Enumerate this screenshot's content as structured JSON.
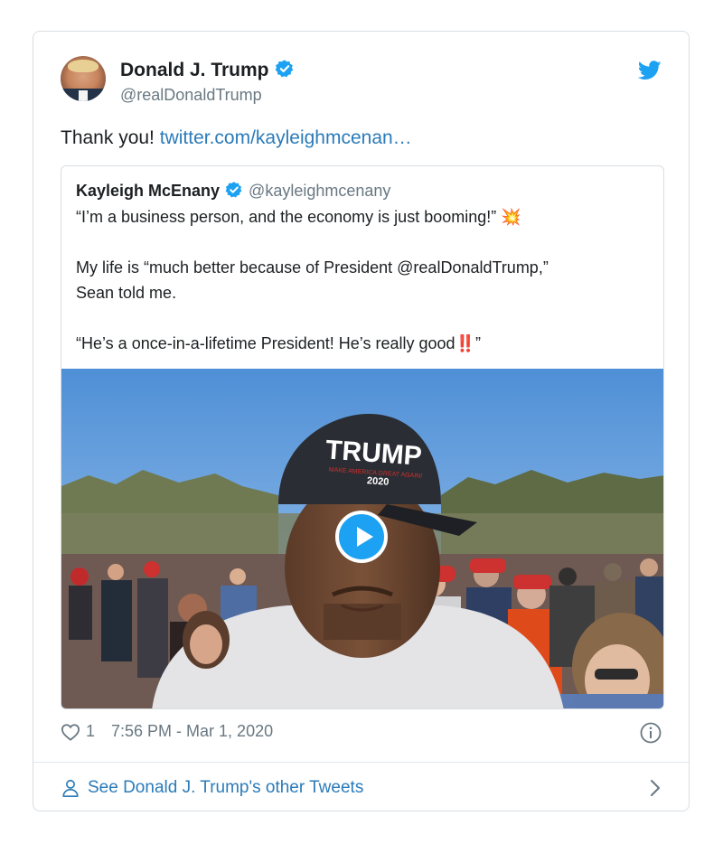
{
  "tweet": {
    "author_name": "Donald J. Trump",
    "author_handle": "@realDonaldTrump",
    "text": "Thank you! ",
    "link_text": "twitter.com/kayleighmcenan…",
    "likes": "1",
    "timestamp": "7:56 PM - Mar 1, 2020"
  },
  "quote": {
    "author_name": "Kayleigh McEnany",
    "author_handle": "@kayleighmcenany",
    "line1": "“I’m a business person, and the economy is just booming!”",
    "line2": "My life is “much better because of President @realDonaldTrump,”",
    "line3": "Sean told me.",
    "line4": "“He’s a once-in-a-lifetime President! He’s really good",
    "line4_end": "”",
    "emoji_collision": "💥",
    "emoji_bangs": "‼️"
  },
  "media": {
    "hat_text": "TRUMP",
    "hat_subtext": "MAKE AMERICA GREAT AGAIN!",
    "hat_year": "2020"
  },
  "footer": {
    "label": "See Donald J. Trump's other Tweets"
  },
  "colors": {
    "brand": "#1da1f2",
    "link": "#2b7bb9",
    "muted": "#697882",
    "border": "#d8dee2"
  },
  "icons": [
    "verified-badge-icon",
    "twitter-bird-icon",
    "play-icon",
    "heart-icon",
    "info-icon",
    "person-icon",
    "chevron-right-icon"
  ]
}
